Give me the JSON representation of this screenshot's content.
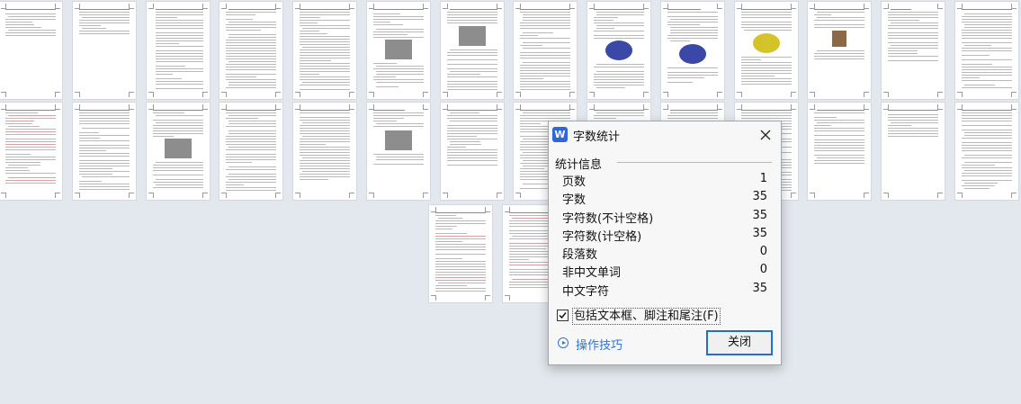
{
  "dialog": {
    "title": "字数统计",
    "app_icon_letter": "W",
    "section_title": "统计信息",
    "stats": [
      {
        "label": "页数",
        "value": "1"
      },
      {
        "label": "字数",
        "value": "35"
      },
      {
        "label": "字符数(不计空格)",
        "value": "35"
      },
      {
        "label": "字符数(计空格)",
        "value": "35"
      },
      {
        "label": "段落数",
        "value": "0"
      },
      {
        "label": "非中文单词",
        "value": "0"
      },
      {
        "label": "中文字符",
        "value": "35"
      }
    ],
    "include_textbox_label": "包括文本框、脚注和尾注(F)",
    "include_textbox_checked": true,
    "tips_label": "操作技巧",
    "close_label": "关闭"
  },
  "colors": {
    "background": "#e3e8ee",
    "accent": "#2f73d9",
    "app_icon": "#2f67d9"
  },
  "document_view": {
    "rows": [
      [
        {
          "lines": 10
        },
        {
          "lines": 10
        },
        {
          "lines": 30,
          "kind": "toc"
        },
        {
          "lines": 34
        },
        {
          "lines": 32
        },
        {
          "lines": 22,
          "kind": "images"
        },
        {
          "lines": 26,
          "kind": "images"
        },
        {
          "lines": 36
        },
        {
          "lines": 22,
          "kind": "blue"
        },
        {
          "lines": 18,
          "kind": "blue"
        },
        {
          "lines": 20,
          "kind": "yellow"
        },
        {
          "lines": 12,
          "kind": "brown"
        },
        {
          "lines": 18
        },
        {
          "lines": 26
        }
      ],
      [
        {
          "lines": 26,
          "kind": "red"
        },
        {
          "lines": 34
        },
        {
          "lines": 20,
          "kind": "images"
        },
        {
          "lines": 30
        },
        {
          "lines": 26
        },
        {
          "lines": 12,
          "kind": "images"
        },
        {
          "lines": 20
        },
        {
          "lines": 28
        },
        {
          "lines": 30
        },
        {
          "lines": 30
        },
        {
          "lines": 28
        },
        {
          "lines": 18
        },
        {
          "lines": 10
        },
        {
          "lines": 30
        }
      ],
      [
        {
          "lines": 34,
          "kind": "red"
        },
        {
          "lines": 26,
          "kind": "red"
        }
      ]
    ]
  }
}
